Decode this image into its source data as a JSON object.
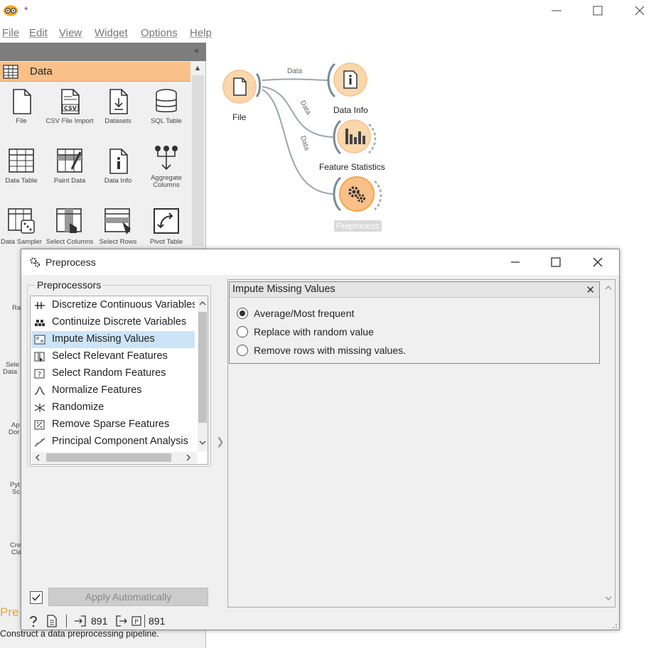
{
  "window": {
    "title": "*"
  },
  "menu": [
    {
      "label": "File"
    },
    {
      "label": "Edit"
    },
    {
      "label": "View"
    },
    {
      "label": "Widget"
    },
    {
      "label": "Options"
    },
    {
      "label": "Help"
    }
  ],
  "toolbox": {
    "category": "Data",
    "widgets": [
      {
        "label": "File",
        "icon": "file-icon"
      },
      {
        "label": "CSV File Import",
        "icon": "csv-icon"
      },
      {
        "label": "Datasets",
        "icon": "datasets-icon"
      },
      {
        "label": "SQL Table",
        "icon": "database-icon"
      },
      {
        "label": "Data Table",
        "icon": "table-icon"
      },
      {
        "label": "Paint Data",
        "icon": "paint-icon"
      },
      {
        "label": "Data Info",
        "icon": "info-icon"
      },
      {
        "label": "Aggregate Columns",
        "icon": "aggregate-icon"
      },
      {
        "label": "Data Sampler",
        "icon": "sampler-icon"
      },
      {
        "label": "Select Columns",
        "icon": "select-columns-icon"
      },
      {
        "label": "Select Rows",
        "icon": "select-rows-icon"
      },
      {
        "label": "Pivot Table",
        "icon": "pivot-icon"
      }
    ],
    "peek_labels": [
      "Ra",
      "Sele",
      "Data",
      "Ap",
      "Dor",
      "Pyt",
      "Sc",
      "Cre",
      "Cla"
    ],
    "help_title": "Pre",
    "help_description": "Construct a data preprocessing pipeline."
  },
  "canvas": {
    "nodes": [
      {
        "label": "File",
        "icon": "file-icon"
      },
      {
        "label": "Data Info",
        "icon": "info-icon"
      },
      {
        "label": "Feature Statistics",
        "icon": "bar-chart-icon"
      },
      {
        "label": "Preprocess",
        "icon": "gears-icon"
      }
    ],
    "links": [
      {
        "label": "Data"
      },
      {
        "label": "Data"
      },
      {
        "label": "Data"
      }
    ]
  },
  "dialog": {
    "title": "Preprocess",
    "preprocessors_group": "Preprocessors",
    "preprocessors": [
      {
        "label": "Discretize Continuous Variables",
        "icon": "discretize-icon"
      },
      {
        "label": "Continuize Discrete Variables",
        "icon": "continuize-icon"
      },
      {
        "label": "Impute Missing Values",
        "icon": "impute-icon",
        "selected": true
      },
      {
        "label": "Select Relevant Features",
        "icon": "select-relevant-icon"
      },
      {
        "label": "Select Random Features",
        "icon": "select-random-icon"
      },
      {
        "label": "Normalize Features",
        "icon": "normalize-icon"
      },
      {
        "label": "Randomize",
        "icon": "randomize-icon"
      },
      {
        "label": "Remove Sparse Features",
        "icon": "remove-sparse-icon"
      },
      {
        "label": "Principal Component Analysis",
        "icon": "pca-icon"
      }
    ],
    "editor": {
      "title": "Impute Missing Values",
      "options": [
        {
          "label": "Average/Most frequent",
          "checked": true
        },
        {
          "label": "Replace with random value",
          "checked": false
        },
        {
          "label": "Remove rows with missing values.",
          "checked": false
        }
      ]
    },
    "apply_auto_checked": true,
    "apply_label": "Apply Automatically",
    "status": {
      "input_count": "891",
      "output_count": "891"
    }
  },
  "colors": {
    "accent_orange": "#f9c089",
    "node_fill": "#fbd7ad",
    "selected_row": "#cce4f7"
  }
}
